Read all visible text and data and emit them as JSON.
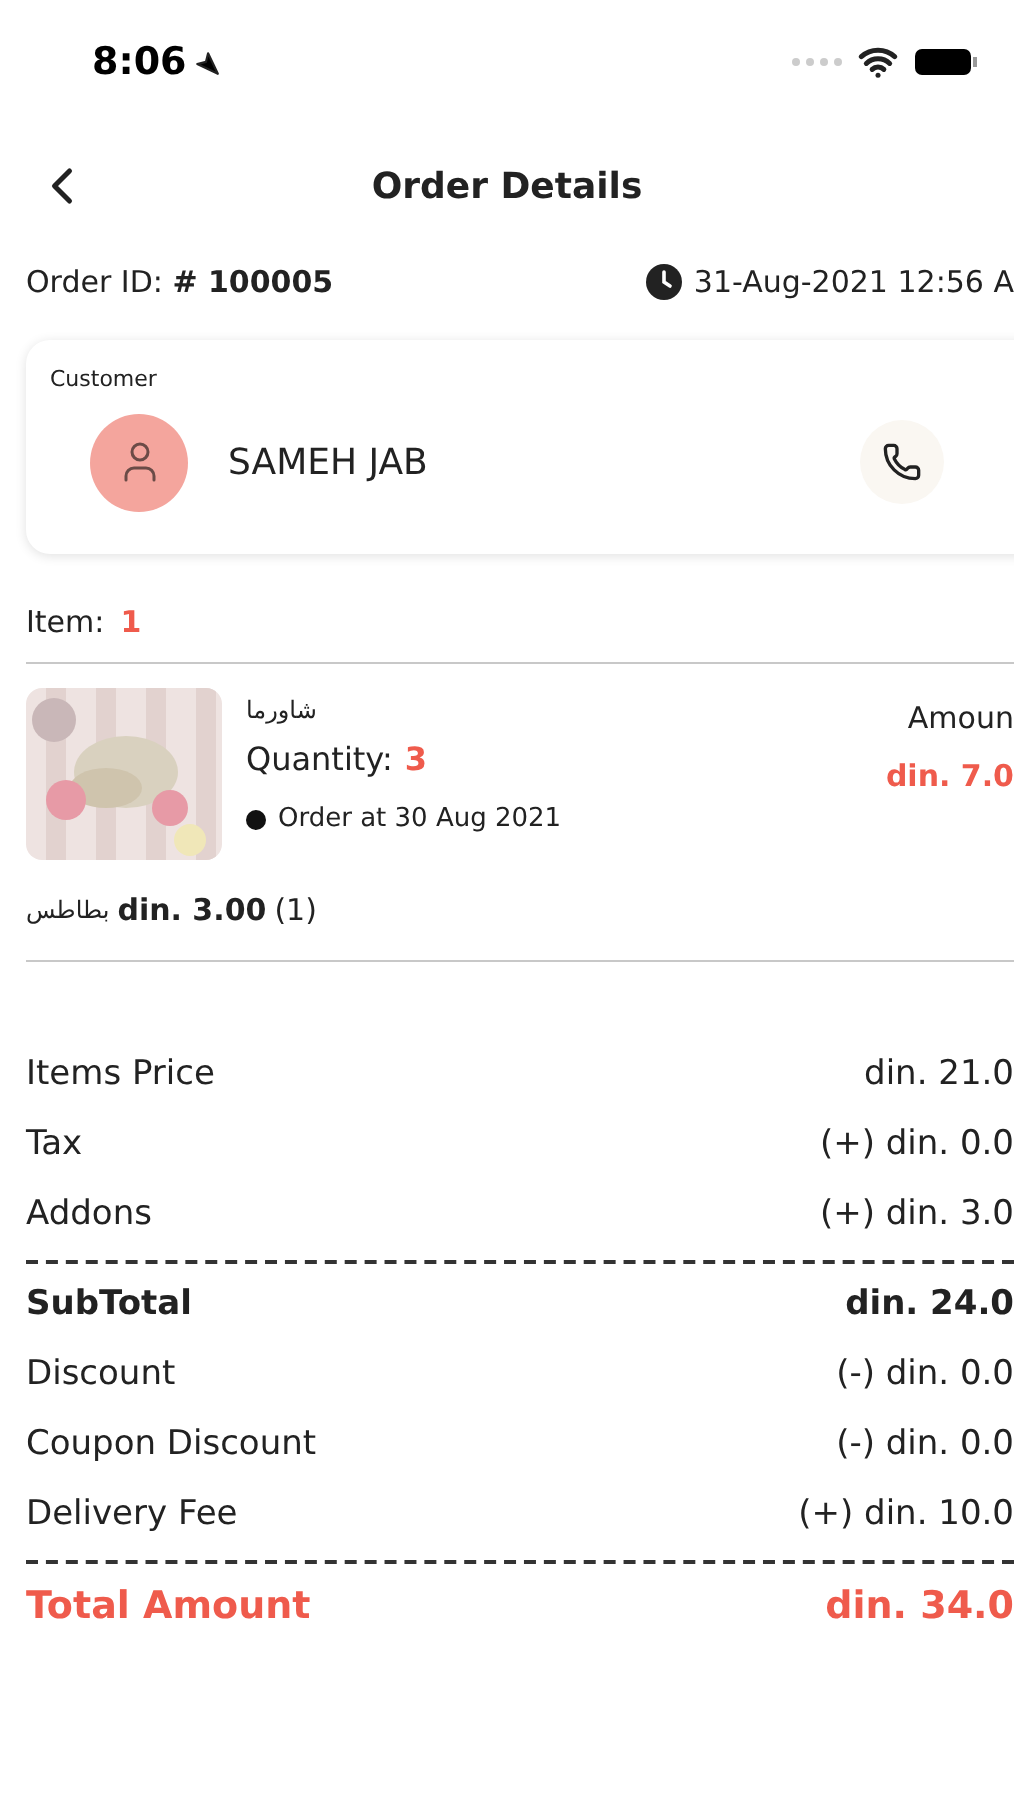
{
  "status_bar": {
    "time": "8:06"
  },
  "header": {
    "title": "Order Details"
  },
  "order": {
    "id_label": "Order ID:",
    "id": "# 100005",
    "date": "31-Aug-2021 12:56 A"
  },
  "customer": {
    "label": "Customer",
    "name": "SAMEH JAB"
  },
  "items_count": {
    "label": "Item:",
    "value": "1"
  },
  "items": [
    {
      "name": "شاورما",
      "quantity_label": "Quantity:",
      "quantity": "3",
      "ordered": "Order at 30 Aug 2021",
      "amount_label": "Amoun",
      "amount": "din. 7.0",
      "addons": [
        {
          "name": "بطاطس",
          "price": "din. 3.00",
          "count": "(1)"
        }
      ]
    }
  ],
  "summary": [
    {
      "kind": "line",
      "label": "Items Price",
      "value": "din. 21.0"
    },
    {
      "kind": "line",
      "label": "Tax",
      "value": "(+) din. 0.0"
    },
    {
      "kind": "line",
      "label": "Addons",
      "value": "(+) din. 3.0"
    },
    {
      "kind": "subtotal",
      "label": "SubTotal",
      "value": "din. 24.0"
    },
    {
      "kind": "line",
      "label": "Discount",
      "value": "(-) din. 0.0"
    },
    {
      "kind": "line",
      "label": "Coupon Discount",
      "value": "(-) din. 0.0"
    },
    {
      "kind": "line",
      "label": "Delivery Fee",
      "value": "(+) din. 10.0"
    },
    {
      "kind": "total",
      "label": "Total Amount",
      "value": "din. 34.0"
    }
  ]
}
